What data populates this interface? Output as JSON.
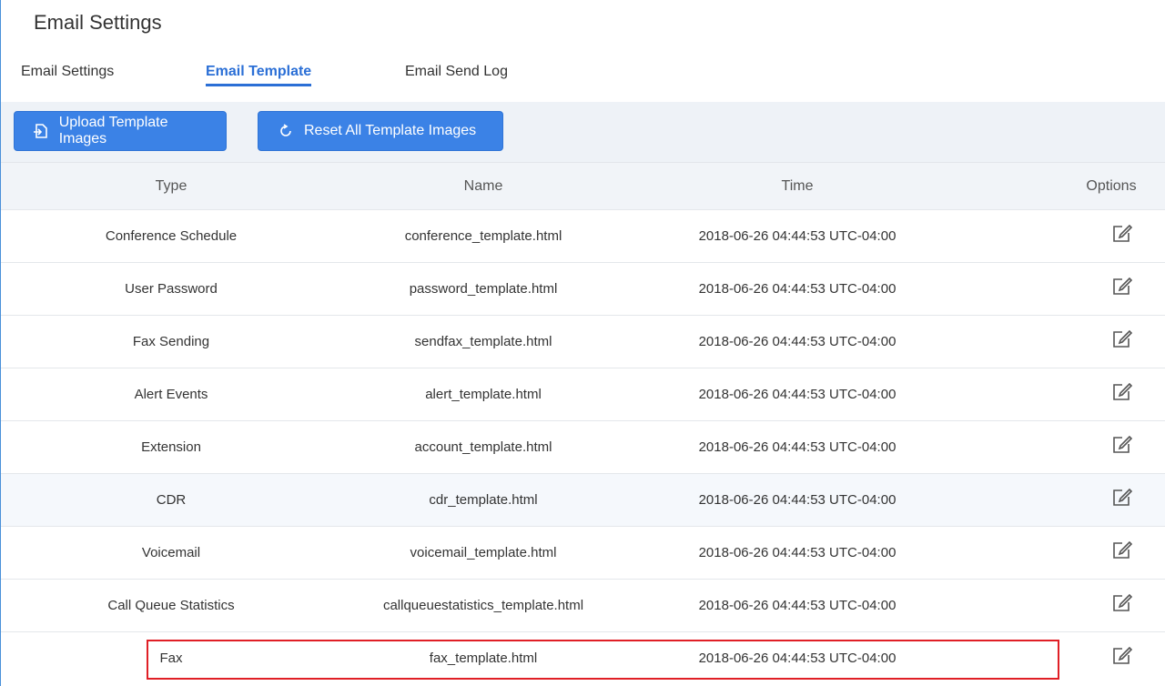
{
  "page": {
    "title": "Email Settings"
  },
  "tabs": [
    {
      "label": "Email Settings",
      "active": false
    },
    {
      "label": "Email Template",
      "active": true
    },
    {
      "label": "Email Send Log",
      "active": false
    }
  ],
  "toolbar": {
    "upload_label": "Upload Template Images",
    "reset_label": "Reset All Template Images"
  },
  "table": {
    "headers": {
      "type": "Type",
      "name": "Name",
      "time": "Time",
      "options": "Options"
    },
    "rows": [
      {
        "type": "Conference Schedule",
        "name": "conference_template.html",
        "time": "2018-06-26 04:44:53 UTC-04:00"
      },
      {
        "type": "User Password",
        "name": "password_template.html",
        "time": "2018-06-26 04:44:53 UTC-04:00"
      },
      {
        "type": "Fax Sending",
        "name": "sendfax_template.html",
        "time": "2018-06-26 04:44:53 UTC-04:00"
      },
      {
        "type": "Alert Events",
        "name": "alert_template.html",
        "time": "2018-06-26 04:44:53 UTC-04:00"
      },
      {
        "type": "Extension",
        "name": "account_template.html",
        "time": "2018-06-26 04:44:53 UTC-04:00"
      },
      {
        "type": "CDR",
        "name": "cdr_template.html",
        "time": "2018-06-26 04:44:53 UTC-04:00"
      },
      {
        "type": "Voicemail",
        "name": "voicemail_template.html",
        "time": "2018-06-26 04:44:53 UTC-04:00"
      },
      {
        "type": "Call Queue Statistics",
        "name": "callqueuestatistics_template.html",
        "time": "2018-06-26 04:44:53 UTC-04:00"
      },
      {
        "type": "Fax",
        "name": "fax_template.html",
        "time": "2018-06-26 04:44:53 UTC-04:00"
      }
    ]
  },
  "icons": {
    "upload": "upload-icon",
    "reset": "refresh-icon",
    "edit": "edit-icon"
  },
  "colors": {
    "accent": "#3b82e6",
    "active_tab": "#2b6fd6",
    "highlight": "#e01f26"
  }
}
